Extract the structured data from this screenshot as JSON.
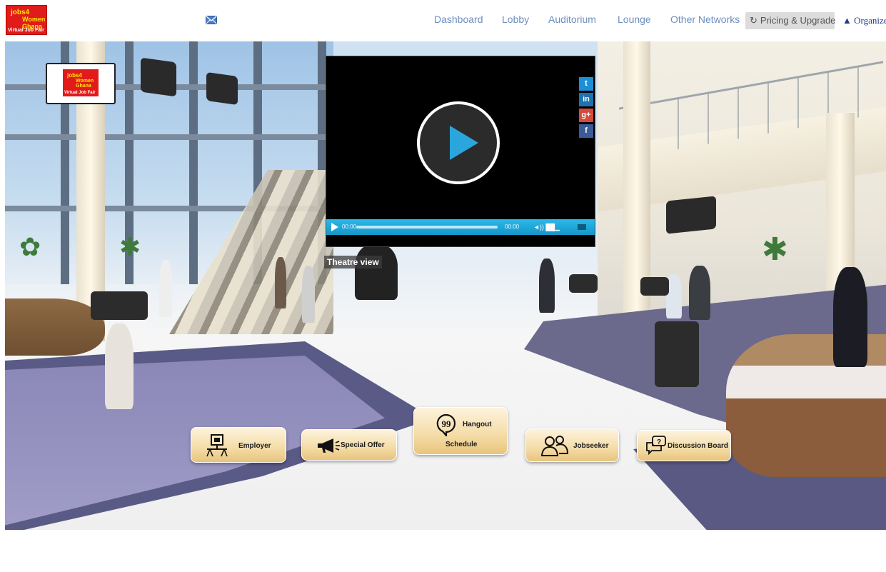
{
  "header": {
    "logo": {
      "line1": "jobs4",
      "line2": "Women Ghana",
      "line3": "Virtual Job Fair"
    },
    "mail_icon": "envelope-icon",
    "nav": [
      {
        "label": "Dashboard"
      },
      {
        "label": "Lobby"
      },
      {
        "label": "Auditorium"
      },
      {
        "label": "Lounge"
      },
      {
        "label": "Other Networks"
      }
    ],
    "pricing": {
      "icon": "refresh-icon",
      "label": "Pricing & Upgrade"
    },
    "organizer": {
      "icon": "user-icon",
      "label": "Organizer"
    }
  },
  "scene": {
    "board_logo": {
      "line1": "jobs4",
      "line2": "Women Ghana",
      "line3": "Virtual Job Fair"
    },
    "player": {
      "current_time": "00:00",
      "duration": "00:00",
      "progress": 0,
      "social": [
        {
          "icon": "twitter-icon",
          "glyph": "t",
          "color": "#1d8fd6"
        },
        {
          "icon": "linkedin-icon",
          "glyph": "in",
          "color": "#1c73b0"
        },
        {
          "icon": "google-plus-icon",
          "glyph": "g+",
          "color": "#d64a3b"
        },
        {
          "icon": "facebook-icon",
          "glyph": "f",
          "color": "#3b5a9a"
        }
      ]
    },
    "theatre_label": "Theatre view",
    "actions": {
      "employer": "Employer",
      "special_offer": "Special Offer",
      "hangout": "Hangout",
      "schedule": "Schedule",
      "jobseeker": "Jobseeker",
      "discussion_board": "Discussion Board"
    }
  }
}
